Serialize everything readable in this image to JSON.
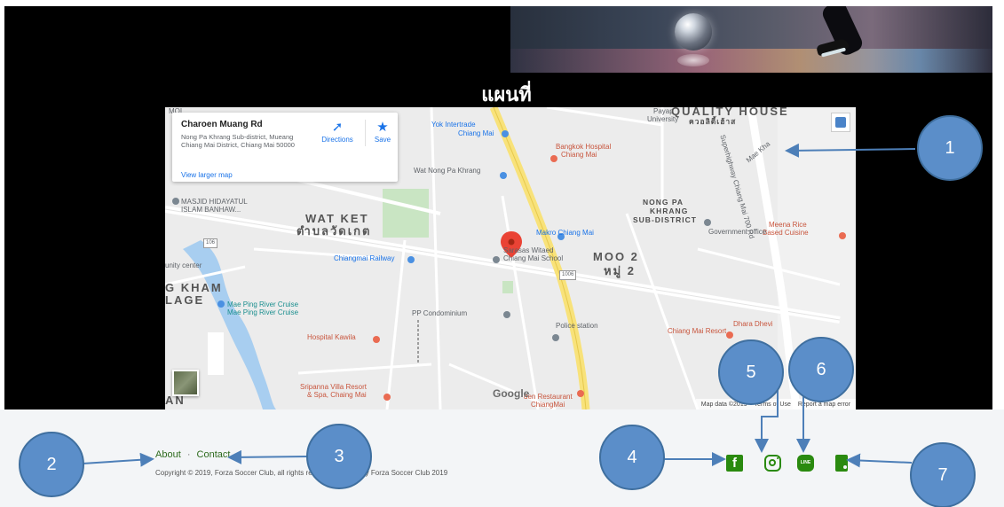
{
  "page": {
    "map_heading": "แผนที่"
  },
  "map": {
    "infocard": {
      "place": "Charoen Muang Rd",
      "address": "Nong Pa Khrang Sub-district, Mueang Chiang Mai District, Chiang Mai 50000",
      "view_larger": "View larger map",
      "directions": "Directions",
      "save": "Save"
    },
    "labels": {
      "moo": "MOI",
      "yok_intertrade": "Yok Intertrade",
      "chiang_mai": "Chiang Mai",
      "payap": "Payap",
      "university": "University",
      "quality_house": "QUALITY HOUSE",
      "quality_house_th": "ควอลิตี้เฮ้าส",
      "wat_nong_pa_khrang": "Wat Nong Pa Khrang",
      "bangkok_hospital": "Bangkok Hospital",
      "bangkok_hospital_2": "Chiang Mai",
      "masjid": "MASJID HIDAYATUL",
      "masjid_2": "ISLAM BANHAW...",
      "wat_ket": "WAT KET",
      "wat_ket_th": "ตำบลวัดเกต",
      "nong_pa_khrang_1": "NONG PA",
      "nong_pa_khrang_2": "KHRANG",
      "nong_pa_khrang_3": "SUB-DISTRICT",
      "makro": "Makro Chiang Mai",
      "sarasas": "Sarasas Witaed",
      "sarasas_2": "Chiang Mai School",
      "railway": "Chiangmai Railway",
      "moo2": "MOO 2",
      "moo2_th": "หมู่ 2",
      "road_1006": "1006",
      "road_106": "106",
      "meena": "Meena Rice",
      "meena_2": "Based Cuisine",
      "gov_office": "Government office",
      "kham": "G KHAM",
      "lage": "LAGE",
      "mae_ping": "Mae Ping River Cruise",
      "mae_ping_2": "Mae Ping River Cruise",
      "community": "unity center",
      "pp_condo": "PP Condominium",
      "police": "Police station",
      "hospital_kawila": "Hospital Kawila",
      "dhara_dhevi": "Dhara Dhevi",
      "dhara_dhevi_2": "Chiang Mai Resort",
      "sripanna": "Sripanna Villa Resort",
      "sripanna_2": "& Spa, Chaing Mai",
      "den_restaurant": "den Restaurant",
      "den_restaurant_2": "ChiangMai",
      "an": "AN",
      "mae_kha": "Mae Kha",
      "superhighway": "Superhighway Chiang Mai 700 Rd"
    },
    "google": "Google",
    "map_data": "Map data ©2019",
    "terms": "Terms of Use",
    "report": "Report a map error"
  },
  "footer": {
    "about": "About",
    "separator": "·",
    "contact": "Contact",
    "copyright": "Copyright © 2019, Forza Soccer Club, all rights reserved. Design by Forza Soccer Club 2019",
    "facebook_glyph": "f",
    "line_glyph": "LINE"
  },
  "callouts": [
    "1",
    "2",
    "3",
    "4",
    "5",
    "6",
    "7"
  ],
  "colors": {
    "callout_fill": "#5b8ec9",
    "social_green": "#2a8a0f",
    "footer_bg": "#f3f5f7",
    "map_link_blue": "#1a73e8"
  }
}
